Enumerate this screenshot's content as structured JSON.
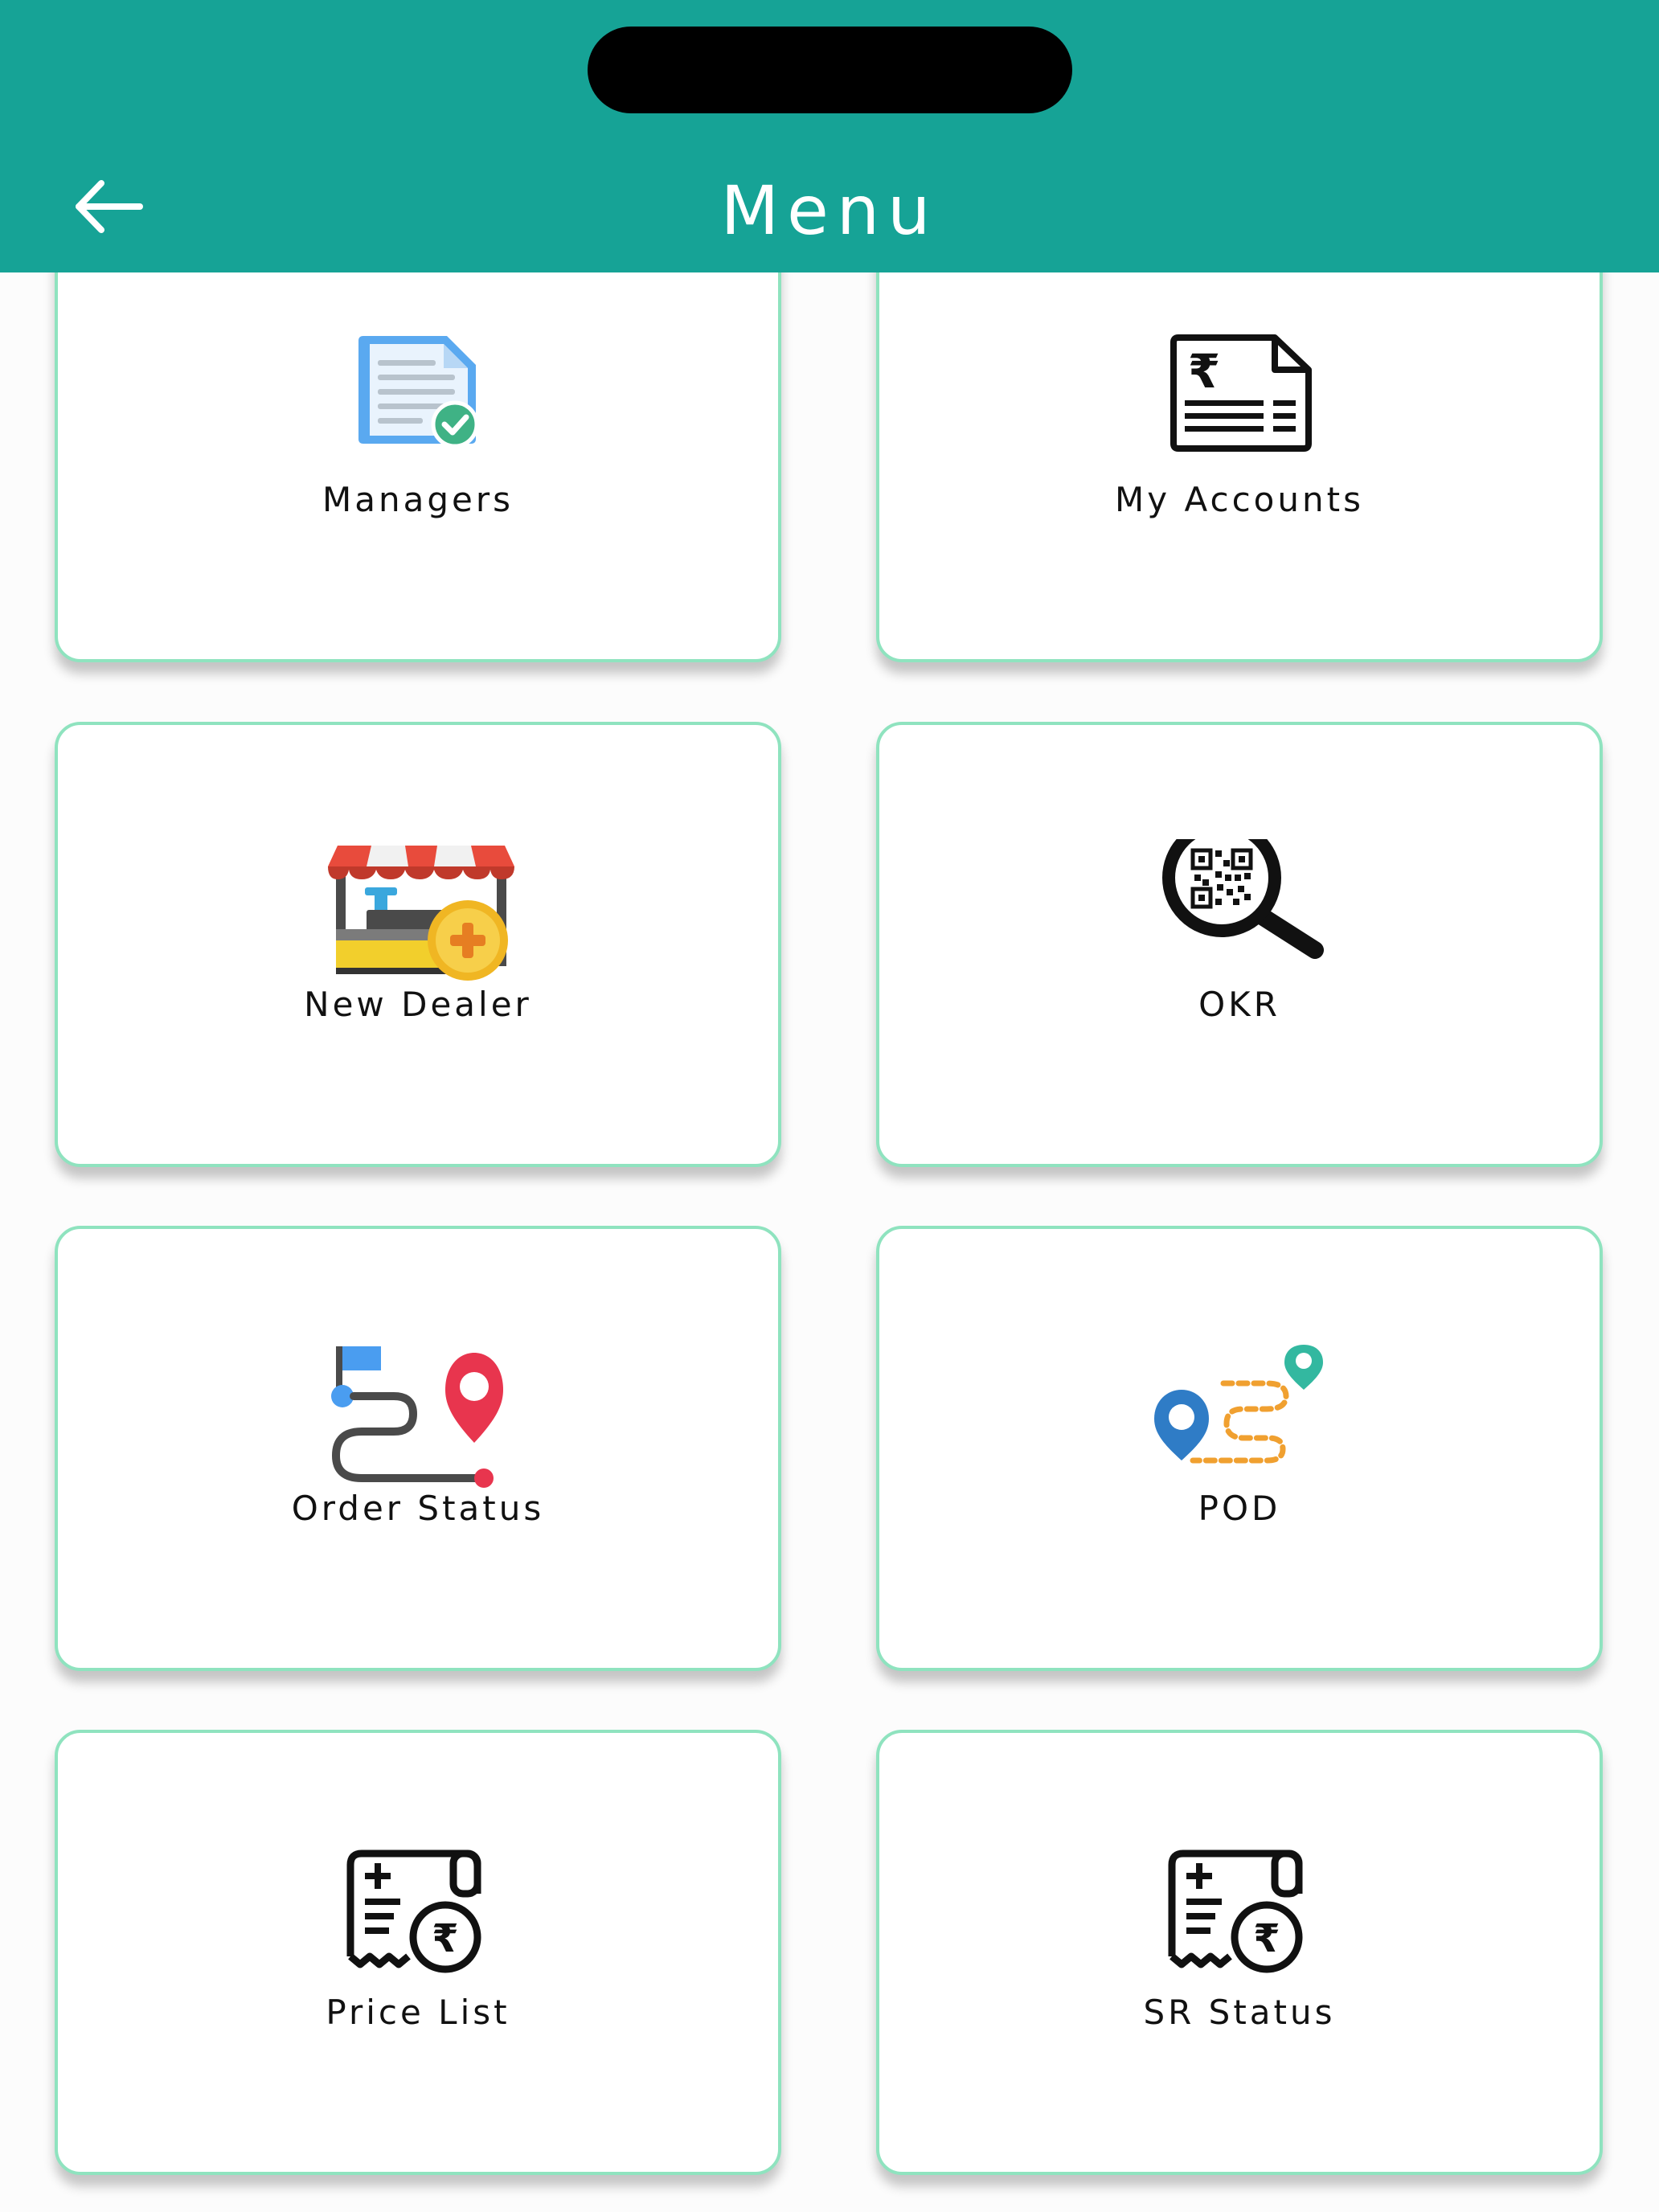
{
  "app_bar": {
    "title": "Menu",
    "back_icon": "arrow-left-icon",
    "background": "#16a396",
    "title_color": "#ffffff"
  },
  "menu": {
    "tile_border_color": "#8fe3bf",
    "items": [
      {
        "label": "Managers",
        "icon": "document-check-icon"
      },
      {
        "label": "My Accounts",
        "icon": "rupee-invoice-icon"
      },
      {
        "label": "New Dealer",
        "icon": "shop-stall-coin-icon"
      },
      {
        "label": "OKR",
        "icon": "qr-magnifier-icon"
      },
      {
        "label": "Order Status",
        "icon": "route-pin-icon"
      },
      {
        "label": "POD",
        "icon": "delivery-route-icon"
      },
      {
        "label": "Price List",
        "icon": "rupee-receipt-icon"
      },
      {
        "label": "SR Status",
        "icon": "rupee-receipt-icon"
      }
    ]
  }
}
